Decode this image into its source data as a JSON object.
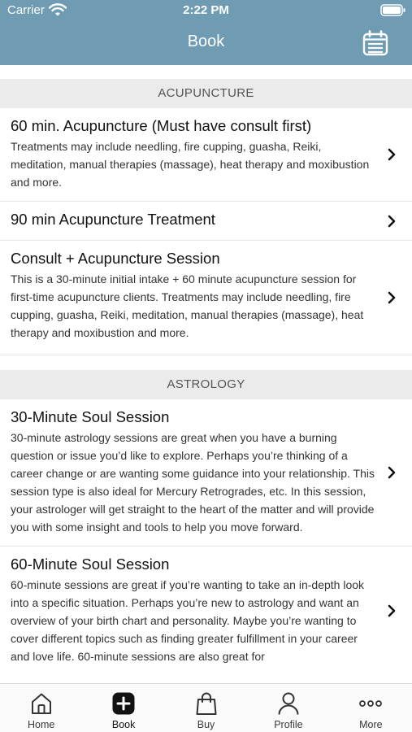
{
  "status_bar": {
    "carrier": "Carrier",
    "time": "2:22 PM"
  },
  "header": {
    "title": "Book"
  },
  "sections": [
    {
      "title": "ACUPUNCTURE",
      "items": [
        {
          "title": "60 min. Acupuncture (Must have consult first)",
          "description": "Treatments may include needling, fire cupping, guasha, Reiki, meditation, manual therapies (massage), heat therapy and moxibustion and more."
        },
        {
          "title": "90 min Acupuncture Treatment",
          "description": ""
        },
        {
          "title": "Consult + Acupuncture Session",
          "description": "This is a 30-minute initial intake + 60 minute acupuncture session for first-time acupuncture clients. Treatments may include needling, fire cupping, guasha, Reiki, meditation, manual therapies (massage), heat therapy and moxibustion and more."
        }
      ]
    },
    {
      "title": "ASTROLOGY",
      "items": [
        {
          "title": "30-Minute Soul Session",
          "description": "30-minute astrology sessions are great when you have a burning question or issue you’d like to explore. Perhaps you’re thinking of a career change or are wanting some guidance into your relationship. This session type is also ideal for Mercury Retrogrades, etc. In this session, your astrologer will get straight to the heart of the matter and will provide you with some insight and tools to help you move forward."
        },
        {
          "title": "60-Minute Soul Session",
          "description": "60-minute sessions are great if you’re wanting to take an in-depth look into a specific situation. Perhaps you’re new to astrology and want an overview of your birth chart and personality. Maybe you’re wanting to cover different topics such as finding greater fulfillment in your career and love life. 60-minute sessions are also great for"
        }
      ]
    }
  ],
  "tabs": [
    {
      "label": "Home",
      "icon": "home-icon",
      "active": false
    },
    {
      "label": "Book",
      "icon": "plus-square-icon",
      "active": true
    },
    {
      "label": "Buy",
      "icon": "shopping-bag-icon",
      "active": false
    },
    {
      "label": "Profile",
      "icon": "person-icon",
      "active": false
    },
    {
      "label": "More",
      "icon": "more-dots-icon",
      "active": false
    }
  ],
  "colors": {
    "header_bg": "#6f9cb3",
    "section_bg": "#ebebeb",
    "tab_bar_bg": "#fafafa"
  }
}
